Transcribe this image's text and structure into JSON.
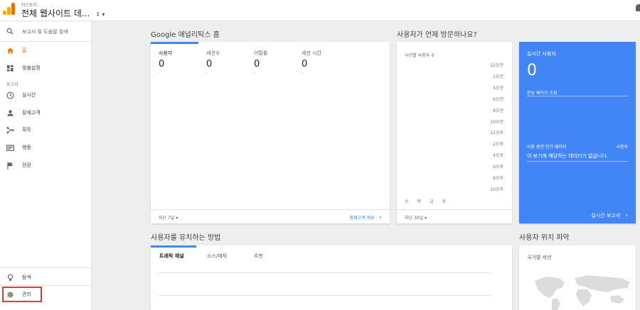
{
  "header": {
    "account_label": "티스토리..",
    "view_title": "전체 웹사이트 데..."
  },
  "sidebar": {
    "search_placeholder": "보고서 및 도움말 검색",
    "home_label": "홈",
    "customization_label": "맞춤설정",
    "reports_section": "보고서",
    "items": [
      {
        "label": "실시간",
        "icon": "clock-icon"
      },
      {
        "label": "잠재고객",
        "icon": "person-icon"
      },
      {
        "label": "획득",
        "icon": "acquisition-icon"
      },
      {
        "label": "행동",
        "icon": "behavior-icon"
      },
      {
        "label": "전환",
        "icon": "flag-icon"
      }
    ],
    "discover_label": "탐색",
    "admin_label": "관리"
  },
  "home": {
    "heading": "Google 애널리틱스 홈",
    "metrics": [
      {
        "label": "사용자",
        "value": "0",
        "delta": "-"
      },
      {
        "label": "세션수",
        "value": "0",
        "delta": "-"
      },
      {
        "label": "이탈률",
        "value": "0",
        "delta": "-"
      },
      {
        "label": "세션 시간",
        "value": "0",
        "delta": "-"
      }
    ],
    "date_range": "지난 7일",
    "report_link": "잠재고객 개요"
  },
  "time": {
    "heading": "사용자가 언제 방문하나요?",
    "title": "시간별 사용자 수",
    "hours": [
      "12오전",
      "2오전",
      "4오전",
      "6오전",
      "8오전",
      "10오전",
      "12오후",
      "2오후",
      "4오후",
      "6오후",
      "8오후",
      "10오후"
    ],
    "days": [
      "수",
      "목",
      "금",
      "토"
    ],
    "date_range": "지난 30일"
  },
  "realtime": {
    "title": "실시간 사용자",
    "value": "0",
    "per_minute": "분당 페이지 조회",
    "top_pages": "사용 중인 인기 페이지",
    "users_col": "사용자",
    "no_data": "이 보기에 해당하는 데이터가 없습니다.",
    "report_link": "실시간 보고서"
  },
  "acquisition": {
    "heading": "사용자를 유치하는 방법",
    "tabs": [
      "트래픽 채널",
      "소스/매체",
      "추천"
    ]
  },
  "geo": {
    "heading": "사용자 위치 파악",
    "title": "국가별 세션"
  },
  "colors": {
    "accent_blue": "#4285f4",
    "active_orange": "#f57c00",
    "link_blue": "#1e88e5",
    "highlight_red": "#e53935"
  }
}
